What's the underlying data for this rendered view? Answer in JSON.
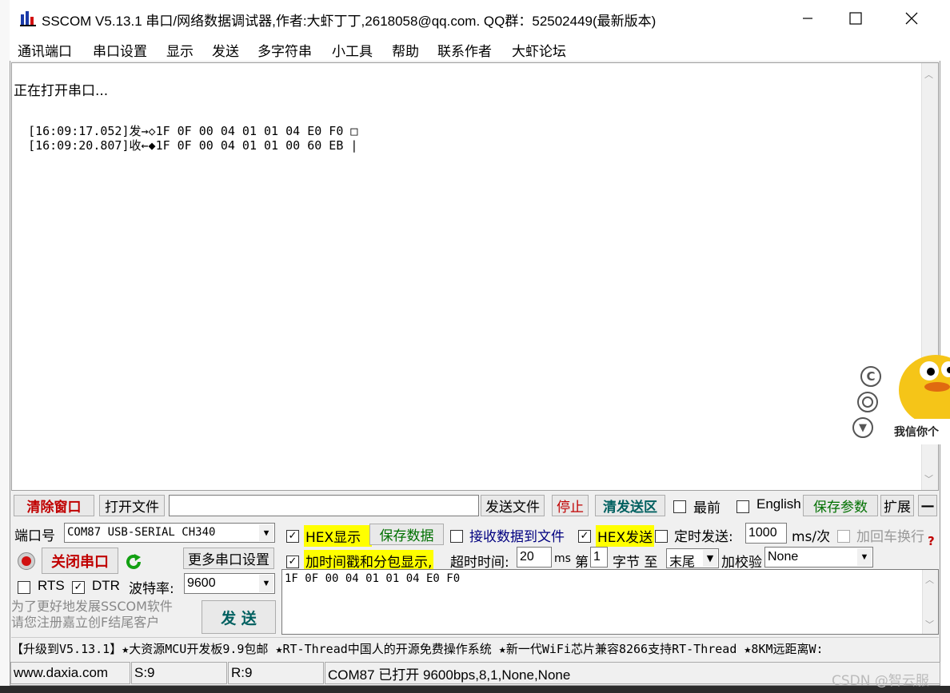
{
  "window": {
    "title": "SSCOM V5.13.1 串口/网络数据调试器,作者:大虾丁丁,2618058@qq.com. QQ群：52502449(最新版本)"
  },
  "menu": [
    "通讯端口",
    "串口设置",
    "显示",
    "发送",
    "多字符串",
    "小工具",
    "帮助",
    "联系作者",
    "大虾论坛"
  ],
  "receive": {
    "status_line": "正在打开串口...",
    "lines": [
      {
        "time": "[16:09:17.052]",
        "dir": "发→◇",
        "data": "1F 0F 00 04 01 01 04 E0 F0 □"
      },
      {
        "time": "[16:09:20.807]",
        "dir": "收←◆",
        "data": "1F 0F 00 04 01 01 00 60 EB |"
      }
    ]
  },
  "floating_icons": [
    "copyright-icon",
    "target-icon",
    "tshirt-icon"
  ],
  "sticker_text": "我信你个",
  "toolbar": {
    "clear_window": "清除窗口",
    "open_file": "打开文件",
    "file_path": "",
    "send_file": "发送文件",
    "stop": "停止",
    "clear_send": "清发送区",
    "topmost": "最前",
    "english": "English",
    "save_params": "保存参数",
    "expand": "扩展",
    "collapse": "—"
  },
  "port": {
    "label": "端口号",
    "value": "COM87 USB-SERIAL CH340",
    "close_port": "关闭串口",
    "more_settings": "更多串口设置",
    "rts": "RTS",
    "dtr": "DTR",
    "baud_label": "波特率:",
    "baud_value": "9600"
  },
  "options": {
    "hex_display": "HEX显示",
    "save_data": "保存数据",
    "recv_to_file": "接收数据到文件",
    "hex_send": "HEX发送",
    "timed_send": "定时发送:",
    "interval": "1000",
    "interval_unit": "ms/次",
    "add_crlf": "加回车换行",
    "add_timestamp": "加时间戳和分包显示,",
    "timeout_label": "超时时间:",
    "timeout_value": "20",
    "timeout_unit": "ms",
    "nth_label": "第",
    "nth_value": "1",
    "byte_label": "字节 至",
    "end_value": "末尾",
    "checksum_label": "加校验",
    "checksum_value": "None"
  },
  "send": {
    "data": "1F 0F 00 04 01 01 04 E0 F0",
    "button": "发 送",
    "promo": "为了更好地发展SSCOM软件\n请您注册嘉立创F结尾客户"
  },
  "ticker": "【升级到V5.13.1】★大资源MCU开发板9.9包邮 ★RT-Thread中国人的开源免费操作系统 ★新一代WiFi芯片兼容8266支持RT-Thread ★8KM远距离W:",
  "status": {
    "website": "www.daxia.com",
    "sent": "S:9",
    "received": "R:9",
    "port_state": "COM87 已打开  9600bps,8,1,None,None"
  },
  "watermark": "CSDN @智云服",
  "colors": {
    "highlight": "#ffff00",
    "accent_red": "#c00000",
    "accent_blue": "#000080"
  }
}
